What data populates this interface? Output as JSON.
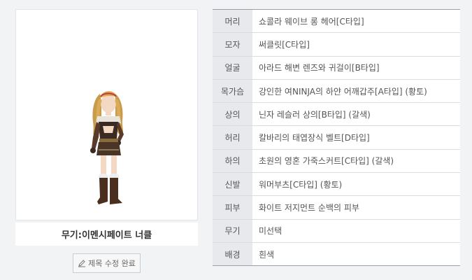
{
  "character": {
    "weapon_caption": "무기:이멘시페이트 너클"
  },
  "actions": {
    "edit_done_label": "제목 수정 완료",
    "edit_icon": "pencil-icon"
  },
  "equipment": [
    {
      "label": "머리",
      "value": "쇼콜라 웨이브 롱 헤어[C타입]"
    },
    {
      "label": "모자",
      "value": "써클릿[C타입]"
    },
    {
      "label": "얼굴",
      "value": "아라드 해변 렌즈와 귀걸이[B타입]"
    },
    {
      "label": "목가슴",
      "value": "강인한 여NINJA의 하얀 어깨갑주[A타입] (황토)"
    },
    {
      "label": "상의",
      "value": "닌자 레슬러 상의[B타입] (갈색)"
    },
    {
      "label": "허리",
      "value": "칼바리의 태엽장식 벨트[D타입]"
    },
    {
      "label": "하의",
      "value": "초원의 영혼 가죽스커트[C타입] (갈색)"
    },
    {
      "label": "신발",
      "value": "워머부츠[C타입] (황토)"
    },
    {
      "label": "피부",
      "value": "화이트 저지먼트 순백의 피부"
    },
    {
      "label": "무기",
      "value": "미선택"
    },
    {
      "label": "배경",
      "value": "흰색"
    }
  ]
}
